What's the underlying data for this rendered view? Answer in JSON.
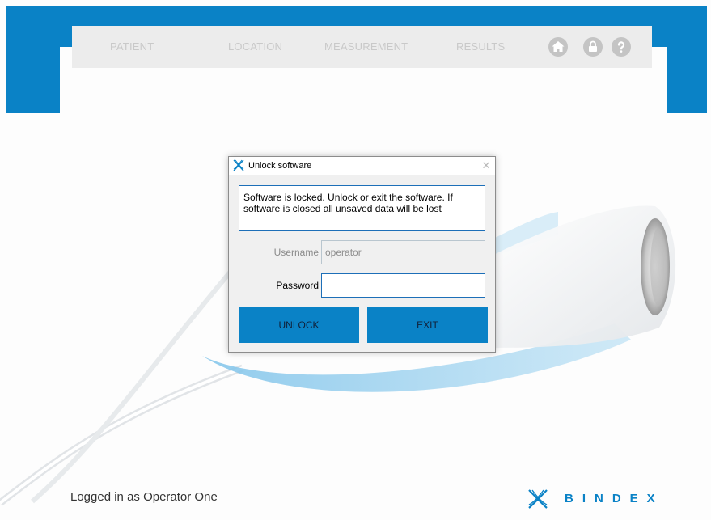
{
  "nav": {
    "items": [
      {
        "label": "PATIENT"
      },
      {
        "label": "LOCATION"
      },
      {
        "label": "MEASUREMENT"
      },
      {
        "label": "RESULTS"
      }
    ],
    "icons": [
      "home-icon",
      "lock-icon",
      "help-icon"
    ]
  },
  "dialog": {
    "title": "Unlock software",
    "close_glyph": "✕",
    "message": "Software is locked. Unlock or exit the software. If software is closed all unsaved data will be lost",
    "username_label": "Username",
    "username_value": "operator",
    "password_label": "Password",
    "password_value": "",
    "unlock_label": "UNLOCK",
    "exit_label": "EXIT"
  },
  "status": {
    "text": "Logged in as Operator One"
  },
  "brand": {
    "name": "BINDEX"
  },
  "colors": {
    "accent": "#0a82c6",
    "nav_bg": "#ececec",
    "nav_text": "#c9c9c9",
    "dialog_bg": "#f0f0f0"
  }
}
